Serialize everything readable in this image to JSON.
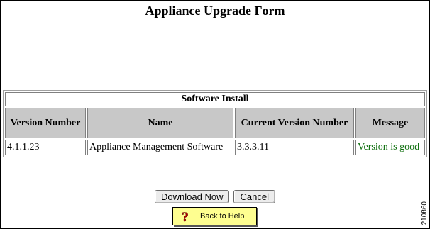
{
  "title": "Appliance Upgrade Form",
  "table": {
    "caption": "Software Install",
    "headers": {
      "version_number": "Version Number",
      "name": "Name",
      "current_version": "Current Version Number",
      "message": "Message"
    },
    "rows": [
      {
        "version_number": "4.1.1.23",
        "name": "Appliance Management Software",
        "current_version": "3.3.3.11",
        "message": "Version is good",
        "message_color": "#107010"
      }
    ]
  },
  "buttons": {
    "download": "Download Now",
    "cancel": "Cancel",
    "back_to_help": "Back to Help",
    "help_icon": "question-mark-icon",
    "help_bg": "#fefe90"
  },
  "figure_id": "210860"
}
